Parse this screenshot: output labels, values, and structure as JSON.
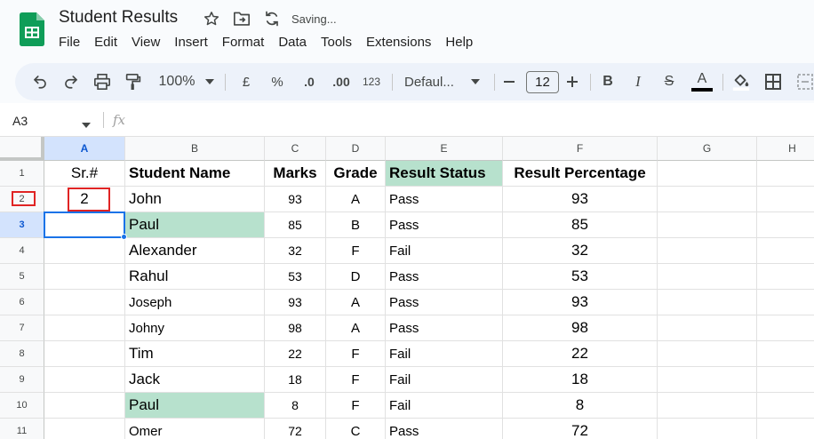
{
  "app": {
    "title": "Student Results",
    "status": "Saving...",
    "brand_color": "#0f9d58"
  },
  "menu": [
    "File",
    "Edit",
    "View",
    "Insert",
    "Format",
    "Data",
    "Tools",
    "Extensions",
    "Help"
  ],
  "toolbar": {
    "zoom": "100%",
    "currency": "£",
    "percent": "%",
    "decrease_decimals": ".0",
    "increase_decimals": ".00",
    "number_format": "123",
    "font": "Defaul...",
    "font_size": "12",
    "bold": "B",
    "italic": "I",
    "strikethrough": "S",
    "text_color": "A"
  },
  "formula_bar": {
    "name_box": "A3",
    "fx": "fx"
  },
  "sheet": {
    "columns": [
      "A",
      "B",
      "C",
      "D",
      "E",
      "F",
      "G",
      "H"
    ],
    "row_numbers": [
      "1",
      "2",
      "3",
      "4",
      "5",
      "6",
      "7",
      "8",
      "9",
      "10",
      "11"
    ],
    "header": {
      "sr": "Sr.#",
      "name": "Student  Name",
      "marks": "Marks",
      "grade": "Grade",
      "status": "Result Status",
      "percentage": "Result Percentage"
    },
    "rows": [
      {
        "sr": "2",
        "name": "John",
        "marks": "93",
        "grade": "A",
        "status": "Pass",
        "pct": "93"
      },
      {
        "sr": "",
        "name": "Paul",
        "marks": "85",
        "grade": "B",
        "status": "Pass",
        "pct": "85"
      },
      {
        "sr": "",
        "name": "Alexander",
        "marks": "32",
        "grade": "F",
        "status": "Fail",
        "pct": "32"
      },
      {
        "sr": "",
        "name": "Rahul",
        "marks": "53",
        "grade": "D",
        "status": "Pass",
        "pct": "53"
      },
      {
        "sr": "",
        "name": "Joseph",
        "marks": "93",
        "grade": "A",
        "status": "Pass",
        "pct": "93"
      },
      {
        "sr": "",
        "name": "Johny",
        "marks": "98",
        "grade": "A",
        "status": "Pass",
        "pct": "98"
      },
      {
        "sr": "",
        "name": "Tim",
        "marks": "22",
        "grade": "F",
        "status": "Fail",
        "pct": "22"
      },
      {
        "sr": "",
        "name": "Jack",
        "marks": "18",
        "grade": "F",
        "status": "Fail",
        "pct": "18"
      },
      {
        "sr": "",
        "name": "Paul",
        "marks": "8",
        "grade": "F",
        "status": "Fail",
        "pct": "8"
      },
      {
        "sr": "",
        "name": "Omer",
        "marks": "72",
        "grade": "C",
        "status": "Pass",
        "pct": "72"
      }
    ],
    "highlight_color": "#b7e1cd",
    "selection_color": "#1a73e8",
    "annotation_color": "#e02424"
  }
}
